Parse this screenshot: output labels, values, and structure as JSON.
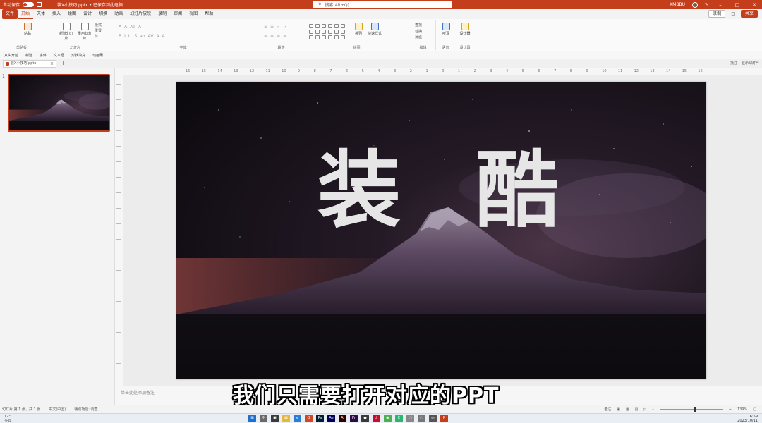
{
  "titlebar": {
    "autosave_label": "自动保存",
    "doc_title": "装X小技巧.pptx • 已保存到此电脑",
    "search_placeholder": "搜索(Alt+Q)",
    "user_name": "KMBBU",
    "accent": "#c43e1c"
  },
  "menu": {
    "file": "文件",
    "tabs": [
      "开始",
      "天体",
      "插入",
      "绘图",
      "设计",
      "切换",
      "动画",
      "幻灯片放映",
      "录制",
      "审阅",
      "视图",
      "帮助"
    ],
    "active_tab": "开始",
    "record_label": "录制",
    "share_label": "共享"
  },
  "ribbon": {
    "groups": [
      {
        "label": "剪贴板",
        "buttons": [
          "粘贴"
        ]
      },
      {
        "label": "幻灯片",
        "buttons": [
          "新建幻灯片",
          "重用幻灯片"
        ]
      },
      {
        "label": "字体",
        "buttons": []
      },
      {
        "label": "段落",
        "buttons": []
      },
      {
        "label": "绘图",
        "buttons": [
          "排列",
          "快速样式"
        ]
      },
      {
        "label": "编辑",
        "buttons": [
          "查找",
          "替换",
          "选择"
        ]
      },
      {
        "label": "语音",
        "buttons": [
          "听写"
        ]
      },
      {
        "label": "设计器",
        "buttons": [
          "设计器"
        ]
      }
    ],
    "layout_items": [
      "版式",
      "重置",
      "节"
    ]
  },
  "quick_access": [
    "从头开始",
    "新建",
    "字体",
    "文本框",
    "形状填充",
    "动画刷"
  ],
  "doc_tab": {
    "name": "装X小技巧.pptx",
    "right_items": [
      "批注",
      "显示幻灯片"
    ]
  },
  "ruler": {
    "h_labels": [
      "16",
      "15",
      "14",
      "13",
      "12",
      "11",
      "10",
      "9",
      "8",
      "7",
      "6",
      "5",
      "4",
      "3",
      "2",
      "1",
      "0",
      "1",
      "2",
      "3",
      "4",
      "5",
      "6",
      "7",
      "8",
      "9",
      "10",
      "11",
      "12",
      "13",
      "14",
      "15",
      "16"
    ]
  },
  "slide": {
    "title_left": "装",
    "title_right": "酷",
    "number": "1"
  },
  "notes_placeholder": "单击此处添加备注",
  "subtitle": "我们只需要打开对应的PPT",
  "status": {
    "slide_info": "幻灯片 第 1 张，共 1 张",
    "language": "中文(中国)",
    "accessibility": "辅助功能: 调查",
    "notes_btn": "备注",
    "zoom": "139%"
  },
  "taskbar": {
    "weather_temp": "12°C",
    "weather_desc": "多云",
    "time": "16:59",
    "date": "2023/10/11"
  }
}
